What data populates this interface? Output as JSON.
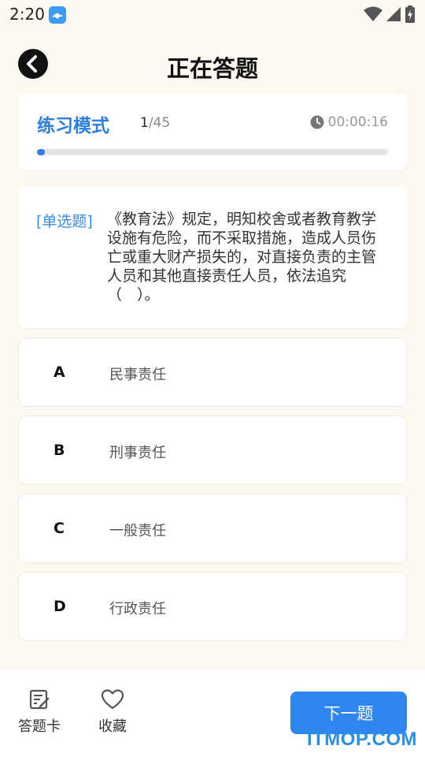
{
  "status_bar": {
    "time": "2:20",
    "icons": [
      "app-notification-icon",
      "wifi-icon",
      "signal-icon",
      "battery-charging-icon"
    ]
  },
  "header": {
    "title": "正在答题",
    "back_icon": "back-arrow-icon"
  },
  "progress": {
    "mode": "练习模式",
    "current": "1",
    "total": "/45",
    "timer": "00:00:16",
    "timer_icon": "clock-icon",
    "fraction": 0.022
  },
  "question": {
    "type": "[单选题]",
    "text": "《教育法》规定，明知校舍或者教育教学设施有危险，而不采取措施，造成人员伤亡或重大财产损失的，对直接负责的主管人员和其他直接责任人员，依法追究（　）。"
  },
  "options": [
    {
      "letter": "A",
      "text": "民事责任"
    },
    {
      "letter": "B",
      "text": "刑事责任"
    },
    {
      "letter": "C",
      "text": "一般责任"
    },
    {
      "letter": "D",
      "text": "行政责任"
    }
  ],
  "bottom_bar": {
    "answer_card_label": "答题卡",
    "answer_card_icon": "answer-sheet-icon",
    "favorite_label": "收藏",
    "favorite_icon": "heart-icon",
    "next_label": "下一题"
  },
  "watermark": "ITMOP.COM",
  "colors": {
    "accent": "#2f7fe2",
    "button": "#2f86f0",
    "background": "#fdf9f1"
  }
}
